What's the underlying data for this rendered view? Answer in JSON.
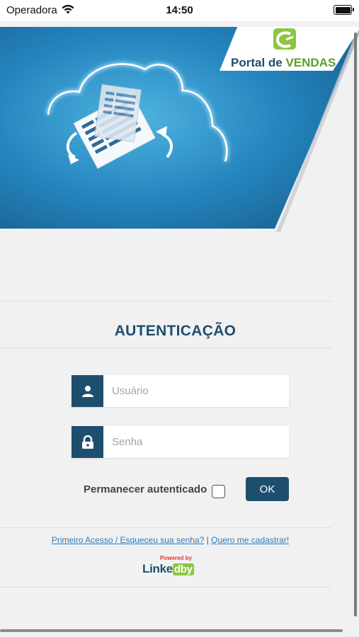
{
  "status_bar": {
    "carrier": "Operadora",
    "time": "14:50"
  },
  "brand": {
    "logo_text_1": "Portal de ",
    "logo_text_2": "VENDAS"
  },
  "login": {
    "title": "AUTENTICAÇÃO",
    "username_placeholder": "Usuário",
    "password_placeholder": "Senha",
    "remember_label": "Permanecer autenticado",
    "ok_label": "OK"
  },
  "footer": {
    "forgot_link": "Primeiro Acesso / Esqueceu sua senha?",
    "separator": "|",
    "register_link": "Quero me cadastrar!",
    "powered_by": "Powered by",
    "vendor_1": "Linke",
    "vendor_2": "dby"
  },
  "colors": {
    "primary": "#1e4e6d",
    "accent_green": "#8cc63f",
    "link": "#2f79b7"
  },
  "icons": [
    "wifi-icon",
    "battery-icon",
    "cloud-sync-icon",
    "user-icon",
    "lock-icon"
  ]
}
